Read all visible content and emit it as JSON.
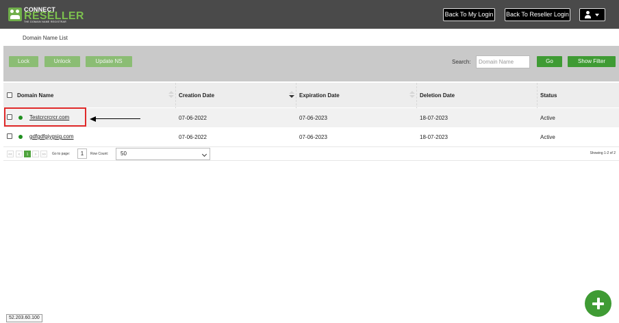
{
  "header": {
    "logo_top": "CONNECT",
    "logo_main": "RESELLER",
    "logo_tag": "THE DOMAIN NAME REGISTRAR",
    "back_my_login": "Back To My Login",
    "back_reseller_login": "Back To Reseller Login",
    "user_menu_icon": "user-icon"
  },
  "breadcrumb": "Domain Name List",
  "toolbar": {
    "lock": "Lock",
    "unlock": "Unlock",
    "update_ns": "Update NS",
    "search_label": "Search:",
    "search_placeholder": "Domain Name",
    "go": "Go",
    "show_filter": "Show Filter"
  },
  "table": {
    "columns": [
      "Domain Name",
      "Creation Date",
      "Expiration Date",
      "Deletion Date",
      "Status"
    ],
    "rows": [
      {
        "domain": "Testcrcrcrcr.com",
        "creation": "07-06-2022",
        "expiration": "07-06-2023",
        "deletion": "18-07-2023",
        "status": "Active"
      },
      {
        "domain": "gdfgdfgiygsig.com",
        "creation": "07-06-2022",
        "expiration": "07-06-2023",
        "deletion": "18-07-2023",
        "status": "Active"
      }
    ]
  },
  "pager": {
    "first": "<<",
    "prev": "<",
    "current": "1",
    "next": ">",
    "last": ">>",
    "goto_label": "Go to page:",
    "goto_value": "1",
    "row_count_label": "Row Count:",
    "row_count_value": "50",
    "showing": "Showing 1-2 of 2"
  },
  "footer": {
    "ip": "52.203.60.100"
  },
  "colors": {
    "topbar": "#4a4a4a",
    "accent_green": "#3f9b34",
    "light_green": "#8bbd74",
    "highlight_red": "#e02828"
  }
}
